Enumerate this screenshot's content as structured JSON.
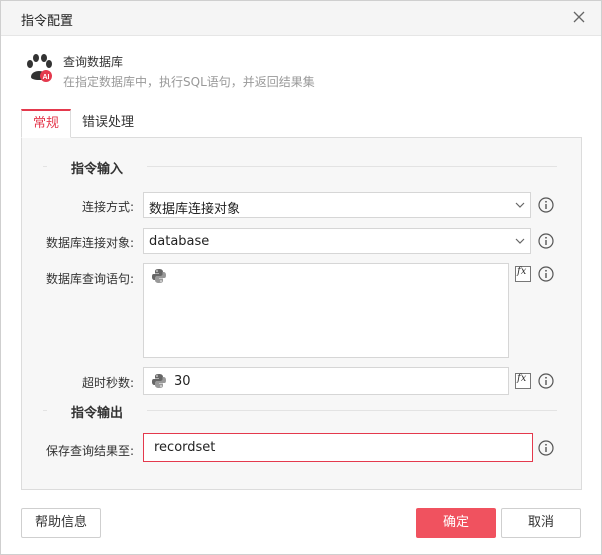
{
  "dialog": {
    "title": "指令配置"
  },
  "header": {
    "name": "查询数据库",
    "description": "在指定数据库中，执行SQL语句，并返回结果集",
    "icon": "paw-ai-icon"
  },
  "tabs": [
    {
      "label": "常规",
      "active": true
    },
    {
      "label": "错误处理",
      "active": false
    }
  ],
  "inputs_section": {
    "title": "指令输入"
  },
  "fields": {
    "connection_mode": {
      "label": "连接方式:",
      "value": "数据库连接对象"
    },
    "db_object": {
      "label": "数据库连接对象:",
      "value": "database"
    },
    "sql": {
      "label": "数据库查询语句:",
      "value": ""
    },
    "timeout": {
      "label": "超时秒数:",
      "value": "30"
    }
  },
  "outputs_section": {
    "title": "指令输出"
  },
  "output": {
    "label": "保存查询结果至:",
    "value": "recordset"
  },
  "buttons": {
    "help": "帮助信息",
    "ok": "确定",
    "cancel": "取消"
  },
  "colors": {
    "accent": "#e4394d",
    "primary_button": "#f0525f"
  }
}
